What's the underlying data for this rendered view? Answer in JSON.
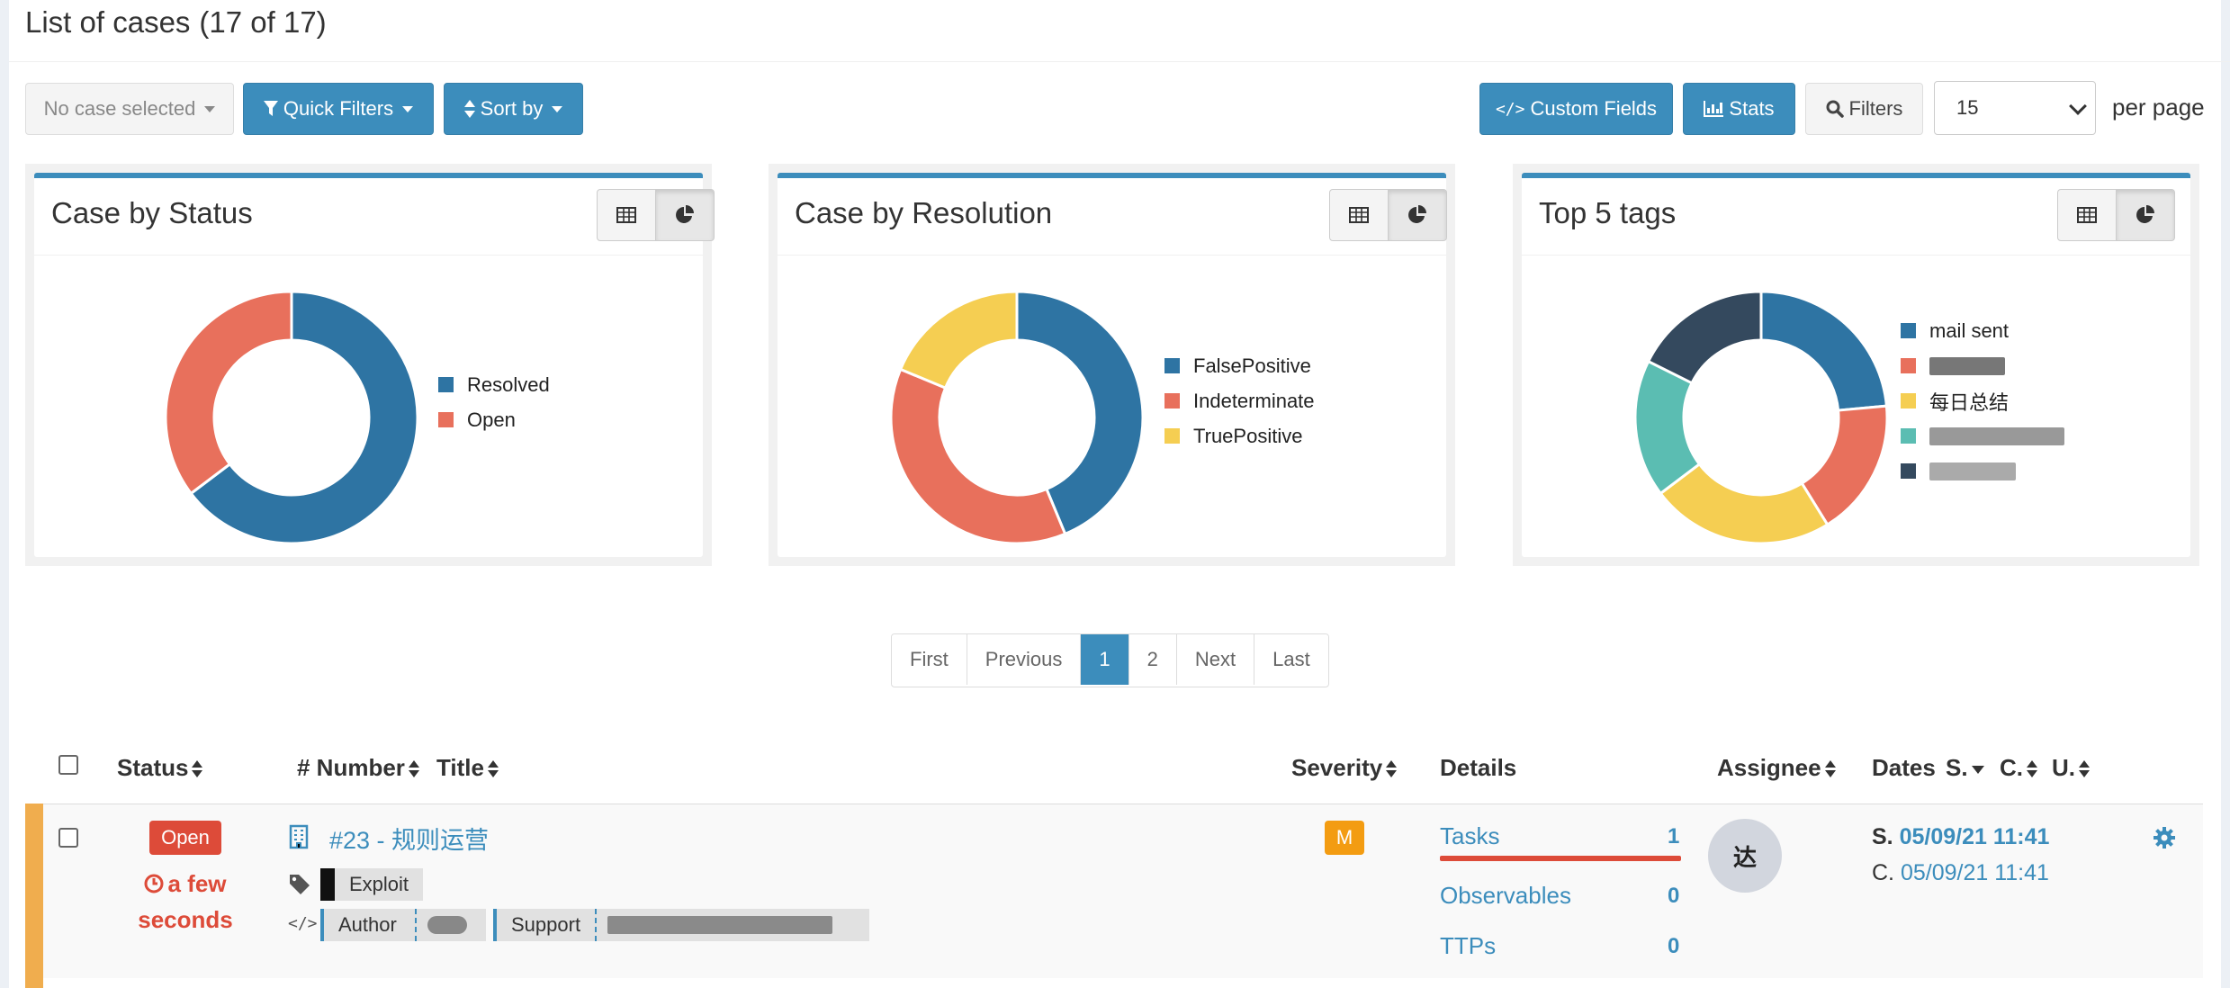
{
  "header": {
    "title": "List of cases",
    "count": "(17 of 17)"
  },
  "toolbar": {
    "no_case_selected": "No case selected",
    "quick_filters": "Quick Filters",
    "sort_by": "Sort by",
    "custom_fields": "Custom Fields",
    "stats": "Stats",
    "filters": "Filters",
    "per_page_value": "15",
    "per_page_label": "per page"
  },
  "widgets": [
    {
      "title": "Case by Status",
      "legend": [
        "Resolved",
        "Open"
      ]
    },
    {
      "title": "Case by Resolution",
      "legend": [
        "FalsePositive",
        "Indeterminate",
        "TruePositive"
      ]
    },
    {
      "title": "Top 5 tags",
      "legend": [
        "mail sent",
        "",
        "每日总结",
        "",
        ""
      ]
    }
  ],
  "chart_data": [
    {
      "type": "pie",
      "title": "Case by Status",
      "categories": [
        "Resolved",
        "Open"
      ],
      "values": [
        11,
        6
      ],
      "colors": [
        "#2e74a3",
        "#e8705c"
      ]
    },
    {
      "type": "pie",
      "title": "Case by Resolution",
      "categories": [
        "FalsePositive",
        "Indeterminate",
        "TruePositive"
      ],
      "values": [
        7,
        6,
        3
      ],
      "colors": [
        "#2e74a3",
        "#e8705c",
        "#f5ce52"
      ]
    },
    {
      "type": "pie",
      "title": "Top 5 tags",
      "categories": [
        "mail sent",
        "",
        "每日总结",
        "",
        ""
      ],
      "values": [
        4,
        3,
        4,
        3,
        3
      ],
      "colors": [
        "#2e74a3",
        "#e8705c",
        "#f5ce52",
        "#5bbdb2",
        "#34495e"
      ]
    }
  ],
  "pagination": {
    "first": "First",
    "previous": "Previous",
    "p1": "1",
    "p2": "2",
    "next": "Next",
    "last": "Last"
  },
  "table": {
    "headers": {
      "status": "Status",
      "number": "# Number",
      "title": "Title",
      "severity": "Severity",
      "details": "Details",
      "assignee": "Assignee",
      "dates": "Dates",
      "s": "S.",
      "c": "C.",
      "u": "U."
    },
    "row": {
      "status": "Open",
      "ago": "a few seconds",
      "title": "#23 - 规则运营",
      "tag": "Exploit",
      "cf_author": "Author",
      "cf_support": "Support",
      "severity": "M",
      "tasks_label": "Tasks",
      "tasks_count": "1",
      "observables_label": "Observables",
      "observables_count": "0",
      "ttps_label": "TTPs",
      "ttps_count": "0",
      "assignee_initial": "达",
      "start_label": "S.",
      "start_date": "05/09/21 11:41",
      "created_label": "C.",
      "created_date": "05/09/21 11:41"
    }
  }
}
